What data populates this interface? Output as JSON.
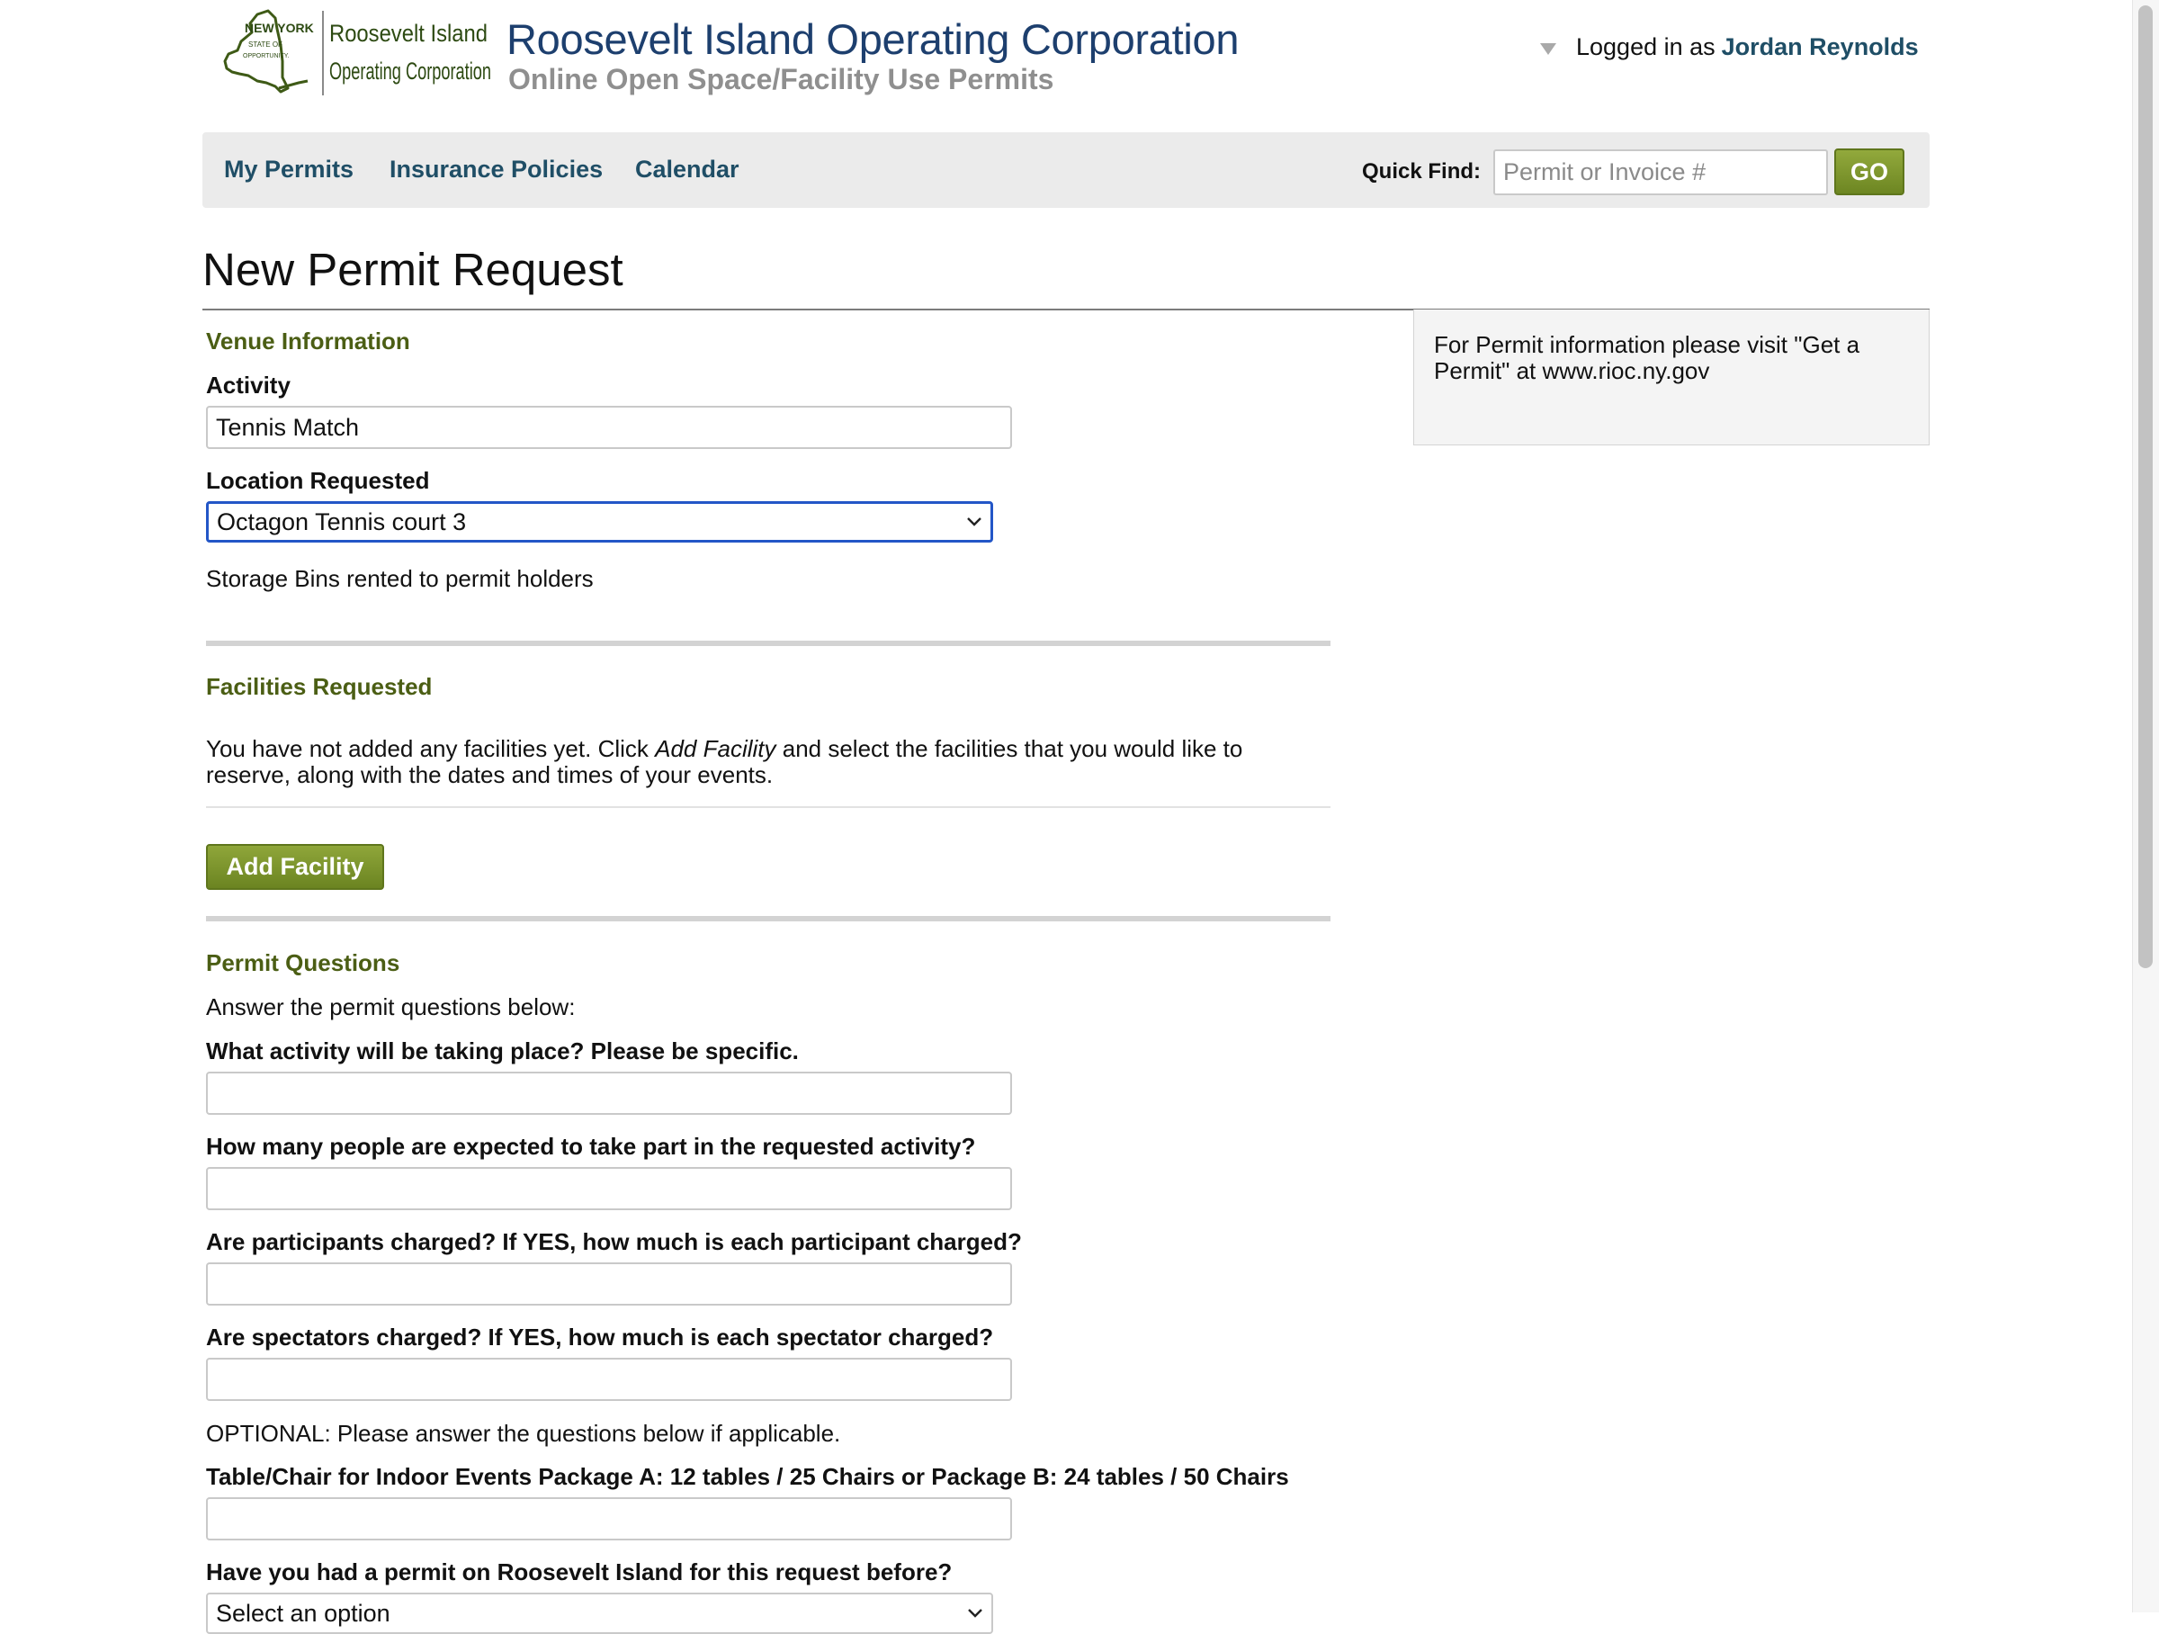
{
  "header": {
    "logo": {
      "state_line1": "NEW YORK",
      "state_line2": "STATE OF",
      "state_line3": "OPPORTUNITY.",
      "name_line1": "Roosevelt Island",
      "name_line2": "Operating Corporation"
    },
    "org_name": "Roosevelt Island Operating Corporation",
    "subtitle": "Online Open Space/Facility Use Permits",
    "logged_in_prefix": "Logged in as",
    "user_name": "Jordan Reynolds"
  },
  "nav": {
    "items": [
      "My Permits",
      "Insurance Policies",
      "Calendar"
    ],
    "quick_find_label": "Quick Find:",
    "quick_find_placeholder": "Permit or Invoice #",
    "go_label": "GO"
  },
  "page": {
    "title": "New Permit Request"
  },
  "info_box": {
    "text": "For Permit information please visit \"Get a Permit\" at www.rioc.ny.gov"
  },
  "venue": {
    "heading": "Venue Information",
    "activity_label": "Activity",
    "activity_value": "Tennis Match",
    "location_label": "Location Requested",
    "location_value": "Octagon Tennis court 3",
    "location_note": "Storage Bins rented to permit holders"
  },
  "facilities": {
    "heading": "Facilities Requested",
    "message_before": "You have not added any facilities yet. Click ",
    "message_emphasis": "Add Facility",
    "message_after": " and select the facilities that you would like to reserve, along with the dates and times of your events.",
    "add_button": "Add Facility"
  },
  "questions": {
    "heading": "Permit Questions",
    "intro": "Answer the permit questions below:",
    "q1": {
      "label": "What activity will be taking place? Please be specific.",
      "value": ""
    },
    "q2": {
      "label": "How many people are expected to take part in the requested activity?",
      "value": ""
    },
    "q3": {
      "label": "Are participants charged? If YES, how much is each participant charged?",
      "value": ""
    },
    "q4": {
      "label": "Are spectators charged? If YES, how much is each spectator charged?",
      "value": ""
    },
    "optional_note": "OPTIONAL: Please answer the questions below if applicable.",
    "q5": {
      "label": "Table/Chair for Indoor Events Package A: 12 tables / 25 Chairs or Package B: 24 tables / 50 Chairs",
      "value": ""
    },
    "q6": {
      "label": "Have you had a permit on Roosevelt Island for this request before?",
      "value": "Select an option"
    }
  },
  "colors": {
    "link_blue": "#1f4e66",
    "org_blue": "#1d3f6e",
    "section_green": "#4b5e14",
    "button_green": "#7a9330",
    "focus_blue": "#2356c7"
  },
  "icons": {
    "user_menu": "caret-down-icon",
    "select_arrow": "chevron-down-icon",
    "logo_map": "new-york-state-map-icon"
  }
}
